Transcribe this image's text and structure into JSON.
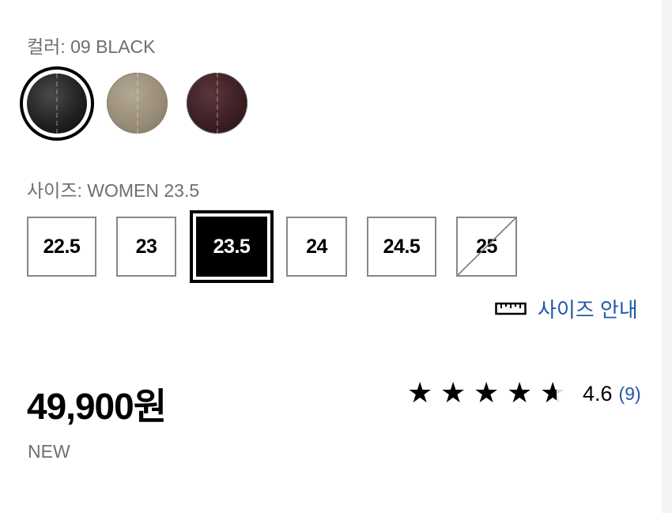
{
  "color": {
    "label": "컬러: 09 BLACK",
    "swatches": [
      {
        "name": "black",
        "color": "#1f1f1f",
        "selected": true
      },
      {
        "name": "taupe",
        "color": "#978b78",
        "selected": false
      },
      {
        "name": "burgundy",
        "color": "#3a1e22",
        "selected": false
      }
    ]
  },
  "size": {
    "label": "사이즈: WOMEN 23.5",
    "options": [
      {
        "label": "22.5",
        "state": "available"
      },
      {
        "label": "23",
        "state": "available"
      },
      {
        "label": "23.5",
        "state": "selected"
      },
      {
        "label": "24",
        "state": "available"
      },
      {
        "label": "24.5",
        "state": "available"
      },
      {
        "label": "25",
        "state": "unavailable"
      }
    ],
    "guide_label": "사이즈 안내",
    "guide_icon": "ruler-icon"
  },
  "price": {
    "value": "49,900원",
    "tag": "NEW"
  },
  "rating": {
    "stars": 4.6,
    "score": "4.6",
    "count": "(9)"
  },
  "colors": {
    "accent": "#2257a8",
    "muted_text": "#6f6f6f",
    "border": "#888888"
  }
}
